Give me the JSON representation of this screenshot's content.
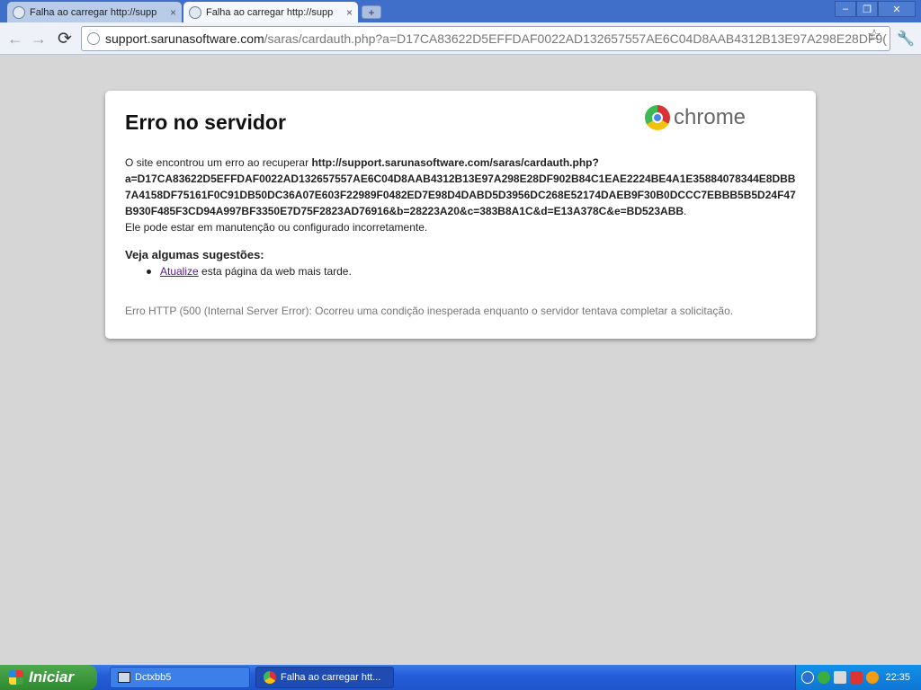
{
  "tabs": [
    {
      "title": "Falha ao carregar http://supp",
      "close": "×"
    },
    {
      "title": "Falha ao carregar http://supp",
      "close": "×"
    }
  ],
  "new_tab_label": "+",
  "window_buttons": {
    "minimize": "–",
    "maximize": "❐",
    "close": "✕"
  },
  "toolbar": {
    "back": "←",
    "forward": "→",
    "reload": "⟳",
    "url_host": "support.sarunasoftware.com",
    "url_path": "/saras/cardauth.php?a=D17CA83622D5EFFDAF0022AD132657557AE6C04D8AAB4312B13E97A298E28DF9(",
    "star": "☆",
    "wrench": "🔧"
  },
  "error": {
    "title": "Erro no servidor",
    "logo_text": "chrome",
    "intro": "O site encontrou um erro ao recuperar ",
    "url": "http://support.sarunasoftware.com/saras/cardauth.php?a=D17CA83622D5EFFDAF0022AD132657557AE6C04D8AAB4312B13E97A298E28DF902B84C1EAE2224BE4A1E35884078344E8DBB7A4158DF75161F0C91DB50DC36A07E603F22989F0482ED7E98D4DABD5D3956DC268E52174DAEB9F30B0DCCC7EBBB5B5D24F47B930F485F3CD94A997BF3350E7D75F2823AD76916&b=28223A20&c=383B8A1C&d=E13A378C&e=BD523ABB",
    "period": ".",
    "tail": "Ele pode estar em manutenção ou configurado incorretamente.",
    "suggestions_title": "Veja algumas sugestões:",
    "reload_link": "Atualize",
    "suggestion_rest": " esta página da web mais tarde.",
    "http_error": "Erro HTTP (500 (Internal Server Error): Ocorreu uma condição inesperada enquanto o servidor tentava completar a solicitação."
  },
  "taskbar": {
    "start_label": "Iniciar",
    "items": [
      {
        "label": "Dctxbb5"
      },
      {
        "label": "Falha ao carregar htt..."
      }
    ],
    "clock": "22:35"
  }
}
